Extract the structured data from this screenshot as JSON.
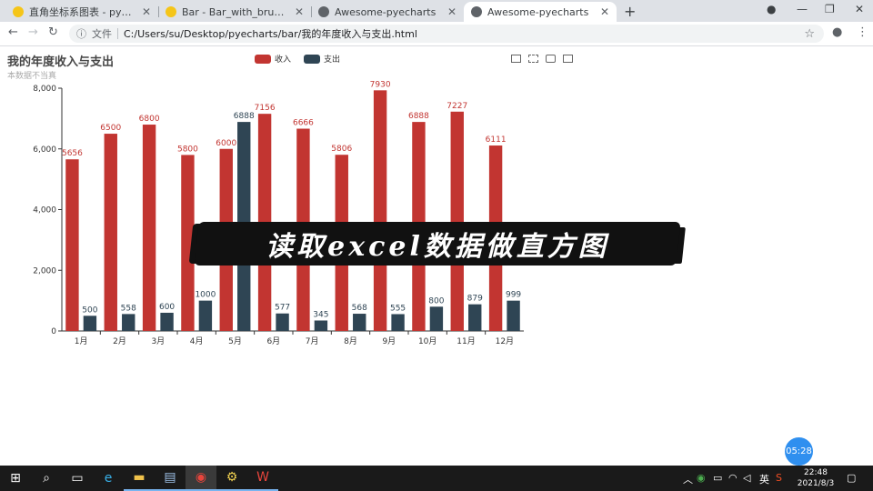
{
  "browser": {
    "tabs": [
      {
        "title": "直角坐标系图表 - pyecharts - A",
        "favicon_color": "#f5c518",
        "active": false
      },
      {
        "title": "Bar - Bar_with_brush - Docume",
        "favicon_color": "#f5c518",
        "active": false
      },
      {
        "title": "Awesome-pyecharts",
        "favicon_color": "#5f6368",
        "active": false
      },
      {
        "title": "Awesome-pyecharts",
        "favicon_color": "#5f6368",
        "active": true
      }
    ],
    "new_tab": "+",
    "address": {
      "scheme_label": "文件",
      "url": "C:/Users/su/Desktop/pyecharts/bar/我的年度收入与支出.html"
    }
  },
  "chart_data": {
    "type": "bar",
    "title": "我的年度收入与支出",
    "subtitle": "本数据不当真",
    "categories": [
      "1月",
      "2月",
      "3月",
      "4月",
      "5月",
      "6月",
      "7月",
      "8月",
      "9月",
      "10月",
      "11月",
      "12月"
    ],
    "series": [
      {
        "name": "收入",
        "color": "#c23531",
        "values": [
          5656,
          6500,
          6800,
          5800,
          6000,
          7156,
          6666,
          5806,
          7930,
          6888,
          7227,
          6111
        ]
      },
      {
        "name": "支出",
        "color": "#2f4554",
        "values": [
          500,
          558,
          600,
          1000,
          6888,
          577,
          345,
          568,
          555,
          800,
          879,
          999
        ]
      }
    ],
    "ylim": [
      0,
      8000
    ],
    "yticks": [
      "0",
      "2,000",
      "4,000",
      "6,000",
      "8,000"
    ],
    "legend_position": "top-center"
  },
  "overlay": {
    "banner_text": "读取excel数据做直方图",
    "timer": "05:28"
  },
  "taskbar": {
    "ime": "英",
    "time": "22:48",
    "date": "2021/8/3"
  }
}
